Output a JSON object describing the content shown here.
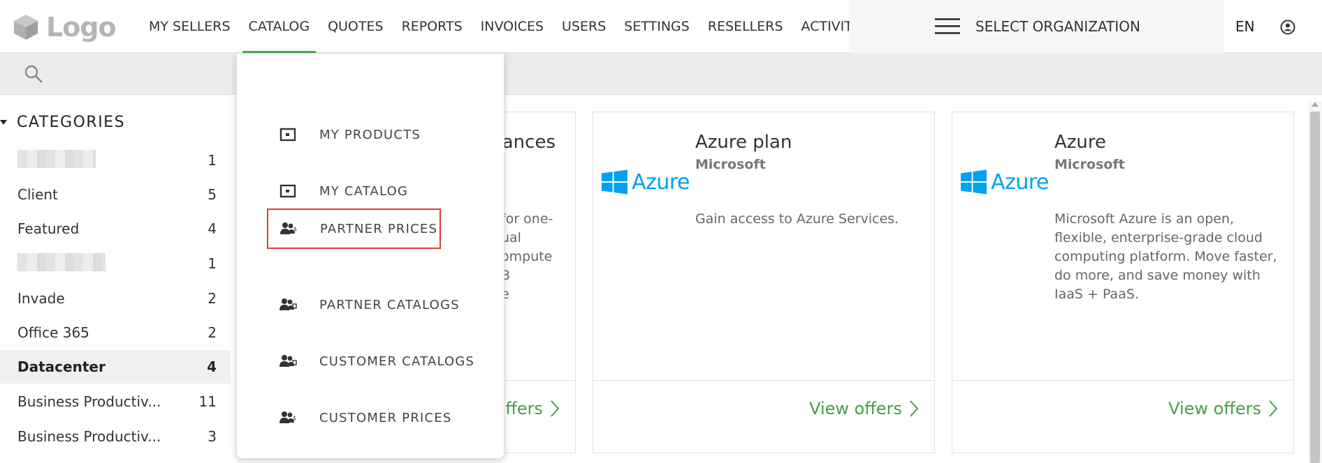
{
  "header": {
    "logo_text": "Logo",
    "nav": [
      "MY SELLERS",
      "CATALOG",
      "QUOTES",
      "REPORTS",
      "INVOICES",
      "USERS",
      "SETTINGS",
      "RESELLERS",
      "ACTIVITY"
    ],
    "active_nav": "CATALOG",
    "org_label": "SELECT ORGANIZATION",
    "lang": "EN",
    "accent_color": "#4caf50"
  },
  "sidebar": {
    "title": "CATEGORIES",
    "items": [
      {
        "name": "",
        "count": "1",
        "redacted": true
      },
      {
        "name": "Client",
        "count": "5"
      },
      {
        "name": "Featured",
        "count": "4"
      },
      {
        "name": "",
        "count": "1",
        "redacted": true
      },
      {
        "name": "Invade",
        "count": "2"
      },
      {
        "name": "Office 365",
        "count": "2"
      },
      {
        "name": "Datacenter",
        "count": "4",
        "active": true
      },
      {
        "name": "Business Productiv...",
        "count": "11"
      },
      {
        "name": "Business Productiv...",
        "count": "3"
      }
    ]
  },
  "dropdown": {
    "items": [
      {
        "label": "MY PRODUCTS",
        "icon": "product-box-icon"
      },
      {
        "label": "MY CATALOG",
        "icon": "product-box-icon"
      },
      {
        "label": "PARTNER PRICES",
        "icon": "people-icon",
        "highlighted": true
      },
      {
        "label": "PARTNER CATALOGS",
        "icon": "people-icon"
      },
      {
        "label": "CUSTOMER CATALOGS",
        "icon": "people-icon"
      },
      {
        "label": "CUSTOMER PRICES",
        "icon": "people-icon"
      }
    ]
  },
  "cards": {
    "partial": {
      "title_fragment": "tances",
      "desc_fragment": "for one-\nual\nompute\nB\ne",
      "cta_fragment": "offers"
    },
    "items": [
      {
        "title": "Azure plan",
        "vendor": "Microsoft",
        "logo_text": "Azure",
        "description": "Gain access to Azure Services.",
        "cta": "View offers"
      },
      {
        "title": "Azure",
        "vendor": "Microsoft",
        "logo_text": "Azure",
        "description": "Microsoft Azure is an open, flexible, enterprise-grade cloud computing platform. Move faster, do more, and save money with IaaS + PaaS.",
        "cta": "View offers"
      }
    ],
    "cta_color": "#43a047",
    "azure_color": "#00a1f1"
  }
}
